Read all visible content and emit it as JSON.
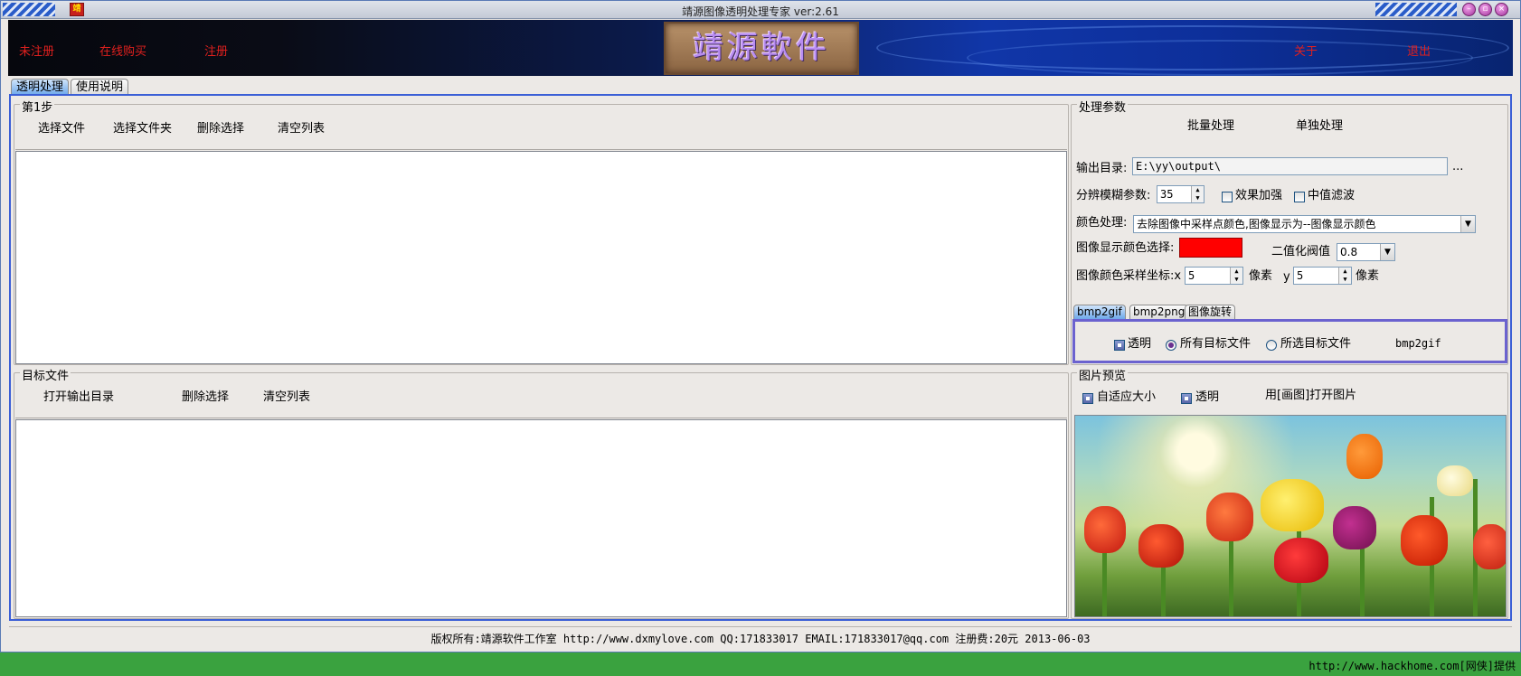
{
  "window": {
    "title": "靖源图像透明处理专家 ver:2.61",
    "app_icon_text": "靖",
    "buttons": [
      "minimize",
      "maximize",
      "close"
    ]
  },
  "banner": {
    "links": [
      "未注册",
      "在线购买",
      "注册",
      "关于",
      "退出"
    ],
    "logo_text": "靖源軟件"
  },
  "main_tabs": [
    {
      "label": "透明处理",
      "active": true
    },
    {
      "label": "使用说明",
      "active": false
    }
  ],
  "step1": {
    "title": "第1步",
    "buttons": [
      "选择文件",
      "选择文件夹",
      "删除选择",
      "清空列表"
    ]
  },
  "target": {
    "title": "目标文件",
    "buttons": [
      "打开输出目录",
      "删除选择",
      "清空列表"
    ]
  },
  "params": {
    "title": "处理参数",
    "mode_buttons": [
      "批量处理",
      "单独处理"
    ],
    "output_dir_label": "输出目录:",
    "output_dir_value": "E:\\yy\\output\\",
    "browse_label": "...",
    "blur_label": "分辨模糊参数:",
    "blur_value": "35",
    "enhance_label": "效果加强",
    "median_label": "中值滤波",
    "color_label": "颜色处理:",
    "color_value": "去除图像中采样点颜色,图像显示为--图像显示颜色",
    "display_color_label": "图像显示颜色选择:",
    "display_color": "#ff0000",
    "threshold_label": "二值化阀值",
    "threshold_value": "0.8",
    "coord_label": "图像颜色采样坐标:x",
    "x_value": "5",
    "pixel_label": "像素",
    "y_label": "y",
    "y_value": "5",
    "pixel_label2": "像素"
  },
  "sub_tabs": [
    {
      "label": "bmp2gif",
      "active": true
    },
    {
      "label": "bmp2png",
      "active": false
    },
    {
      "label": "图像旋转",
      "active": false
    }
  ],
  "bmp2gif": {
    "transparent_label": "透明",
    "all_label": "所有目标文件",
    "selected_label": "所选目标文件",
    "action_label": "bmp2gif"
  },
  "preview": {
    "title": "图片预览",
    "autofit_label": "自适应大小",
    "transparent_label": "透明",
    "open_paint_label": "用[画图]打开图片"
  },
  "status_text": "版权所有:靖源软件工作室 http://www.dxmylove.com QQ:171833017 EMAIL:171833017@qq.com 注册费:20元 2013-06-03",
  "watermark": "http://www.hackhome.com[网侠]提供"
}
